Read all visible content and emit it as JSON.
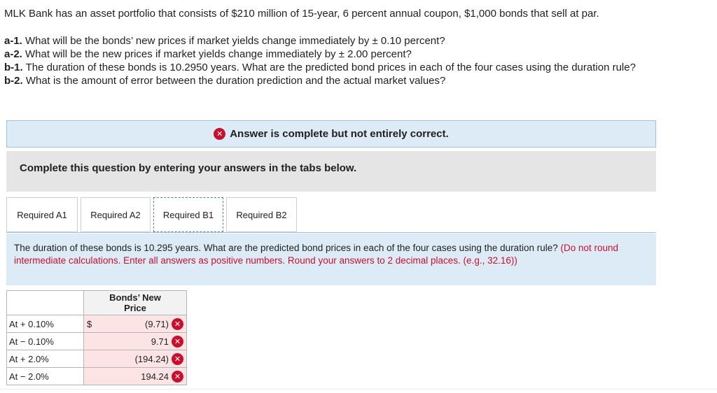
{
  "problem": {
    "intro": "MLK Bank has an asset portfolio that consists of $210 million of 15-year, 6 percent annual coupon, $1,000 bonds that sell at par.",
    "parts": [
      {
        "tag": "a-1.",
        "text": " What will be the bonds’ new prices if market yields change immediately by ± 0.10 percent?"
      },
      {
        "tag": "a-2.",
        "text": " What will be the new prices if market yields change immediately by ± 2.00 percent?"
      },
      {
        "tag": "b-1.",
        "text": " The duration of these bonds is 10.2950 years. What are the predicted bond prices in each of the four cases using the duration rule?"
      },
      {
        "tag": "b-2.",
        "text": " What is the amount of error between the duration prediction and the actual market values?"
      }
    ]
  },
  "banner": {
    "text": "Answer is complete but not entirely correct.",
    "icon": "x-circle-icon",
    "color": "#c8102e"
  },
  "instructions": "Complete this question by entering your answers in the tabs below.",
  "tabs": [
    "Required A1",
    "Required A2",
    "Required B1",
    "Required B2"
  ],
  "active_tab": "Required B1",
  "question": {
    "text": "The duration of these bonds is 10.295 years. What are the predicted bond prices in each of the four cases using the duration rule?",
    "note": "(Do not round intermediate calculations. Enter all answers as positive numbers. Round your answers to 2 decimal places. (e.g., 32.16))"
  },
  "table": {
    "header": "Bonds’ New Price",
    "currency": "$",
    "rows": [
      {
        "label": "At + 0.10%",
        "value": "(9.71)",
        "status": "incorrect"
      },
      {
        "label": "At − 0.10%",
        "value": "9.71",
        "status": "incorrect"
      },
      {
        "label": "At + 2.0%",
        "value": "(194.24)",
        "status": "incorrect"
      },
      {
        "label": "At − 2.0%",
        "value": "194.24",
        "status": "incorrect"
      }
    ]
  }
}
